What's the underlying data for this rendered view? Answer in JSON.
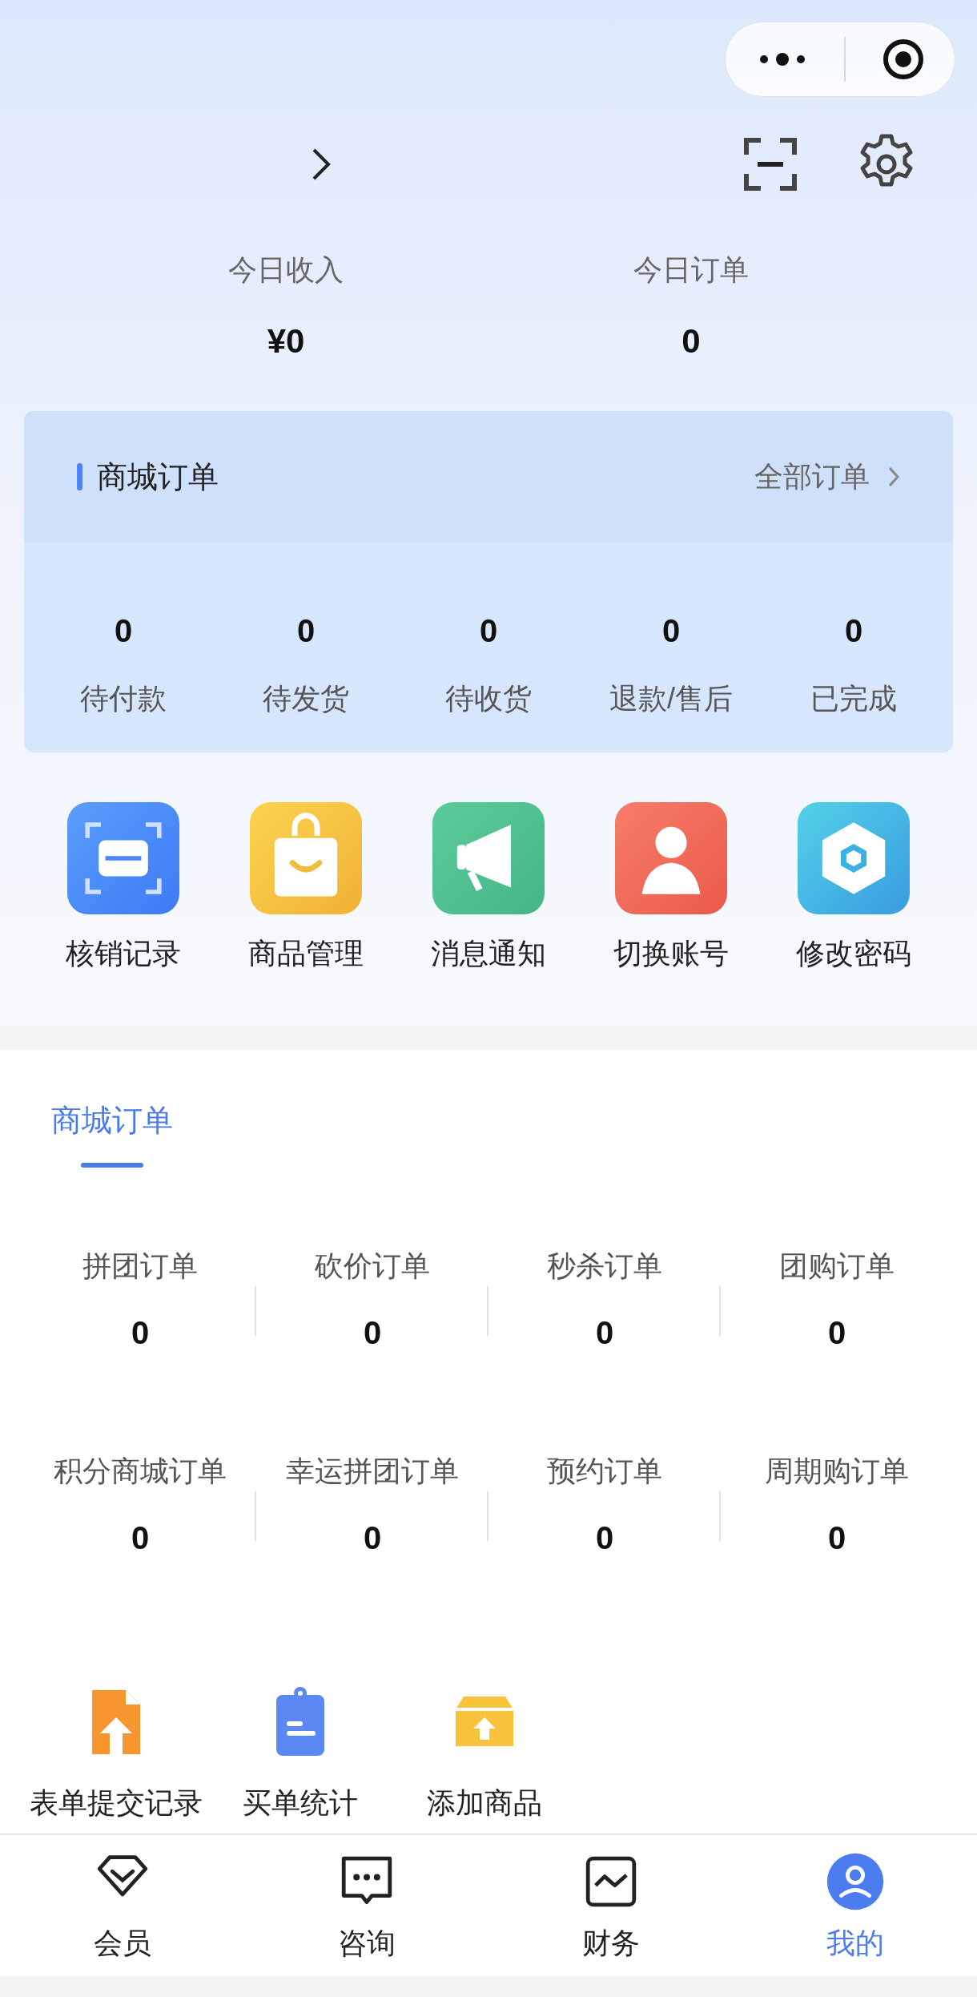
{
  "summary": [
    {
      "label": "今日收入",
      "value": "¥0"
    },
    {
      "label": "今日订单",
      "value": "0"
    }
  ],
  "order_card": {
    "title": "商城订单",
    "link": "全部订单",
    "stats": [
      {
        "value": "0",
        "label": "待付款"
      },
      {
        "value": "0",
        "label": "待发货"
      },
      {
        "value": "0",
        "label": "待收货"
      },
      {
        "value": "0",
        "label": "退款/售后"
      },
      {
        "value": "0",
        "label": "已完成"
      }
    ]
  },
  "shortcuts": [
    {
      "kind": "scan",
      "label": "核销记录"
    },
    {
      "kind": "bag",
      "label": "商品管理"
    },
    {
      "kind": "megaphone",
      "label": "消息通知"
    },
    {
      "kind": "person",
      "label": "切换账号"
    },
    {
      "kind": "hexagon",
      "label": "修改密码"
    }
  ],
  "tabs": [
    {
      "label": "商城订单",
      "selected": true
    }
  ],
  "order_types": [
    {
      "label": "拼团订单",
      "value": "0"
    },
    {
      "label": "砍价订单",
      "value": "0"
    },
    {
      "label": "秒杀订单",
      "value": "0"
    },
    {
      "label": "团购订单",
      "value": "0"
    },
    {
      "label": "积分商城订单",
      "value": "0"
    },
    {
      "label": "幸运拼团订单",
      "value": "0"
    },
    {
      "label": "预约订单",
      "value": "0"
    },
    {
      "label": "周期购订单",
      "value": "0"
    }
  ],
  "tools": [
    {
      "kind": "file-upload",
      "label": "表单提交记录"
    },
    {
      "kind": "clipboard",
      "label": "买单统计"
    },
    {
      "kind": "box-upload",
      "label": "添加商品"
    }
  ],
  "tab_bar": [
    {
      "kind": "diamond",
      "label": "会员",
      "selected": false
    },
    {
      "kind": "chat",
      "label": "咨询",
      "selected": false
    },
    {
      "kind": "chart",
      "label": "财务",
      "selected": false
    },
    {
      "kind": "user",
      "label": "我的",
      "selected": true
    }
  ]
}
